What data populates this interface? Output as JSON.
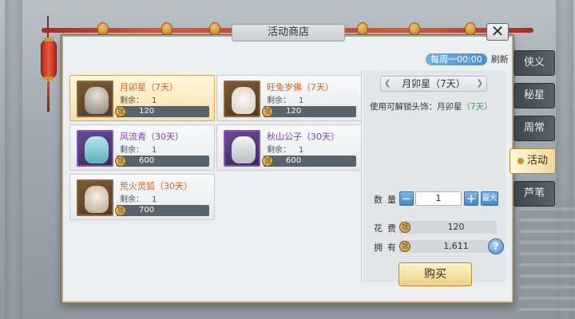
{
  "window": {
    "title": "活动商店"
  },
  "refresh": {
    "time": "每周一00:00",
    "label": "刷新"
  },
  "items": [
    {
      "name": "月卯星（7天）",
      "remain_label": "剩余：",
      "remain": "1",
      "price": "120",
      "color": "#d1621c",
      "rarity": "orange",
      "selected": true
    },
    {
      "name": "旺兔岁佛（7天）",
      "remain_label": "剩余：",
      "remain": "1",
      "price": "120",
      "color": "#d1621c",
      "rarity": "orange",
      "selected": false
    },
    {
      "name": "风流青（30天）",
      "remain_label": "剩余：",
      "remain": "1",
      "price": "600",
      "color": "#7a3fb0",
      "rarity": "purple",
      "selected": false
    },
    {
      "name": "秋山公子（30天）",
      "remain_label": "剩余：",
      "remain": "1",
      "price": "600",
      "color": "#7a3fb0",
      "rarity": "purple",
      "selected": false
    },
    {
      "name": "荒火灵狐（30天）",
      "remain_label": "剩余：",
      "remain": "1",
      "price": "700",
      "color": "#d1621c",
      "rarity": "orange",
      "selected": false
    }
  ],
  "detail": {
    "name": "月卯星（7天）",
    "desc_prefix": "使用可解锁头饰：月卯星",
    "desc_suffix": "（7天）",
    "qty_label": "数量",
    "qty_value": "1",
    "max_label": "最大",
    "cost_label": "花费",
    "cost_value": "120",
    "own_label": "拥有",
    "own_value": "1,611",
    "buy_label": "购买",
    "help_glyph": "?"
  },
  "side_tabs": [
    {
      "label": "侠义",
      "active": false
    },
    {
      "label": "秘星",
      "active": false
    },
    {
      "label": "周常",
      "active": false
    },
    {
      "label": "活动",
      "active": true
    },
    {
      "label": "芦苇",
      "active": false
    }
  ],
  "coin_glyph": "银",
  "close_glyph": "✕",
  "minus_glyph": "−",
  "plus_glyph": "+"
}
